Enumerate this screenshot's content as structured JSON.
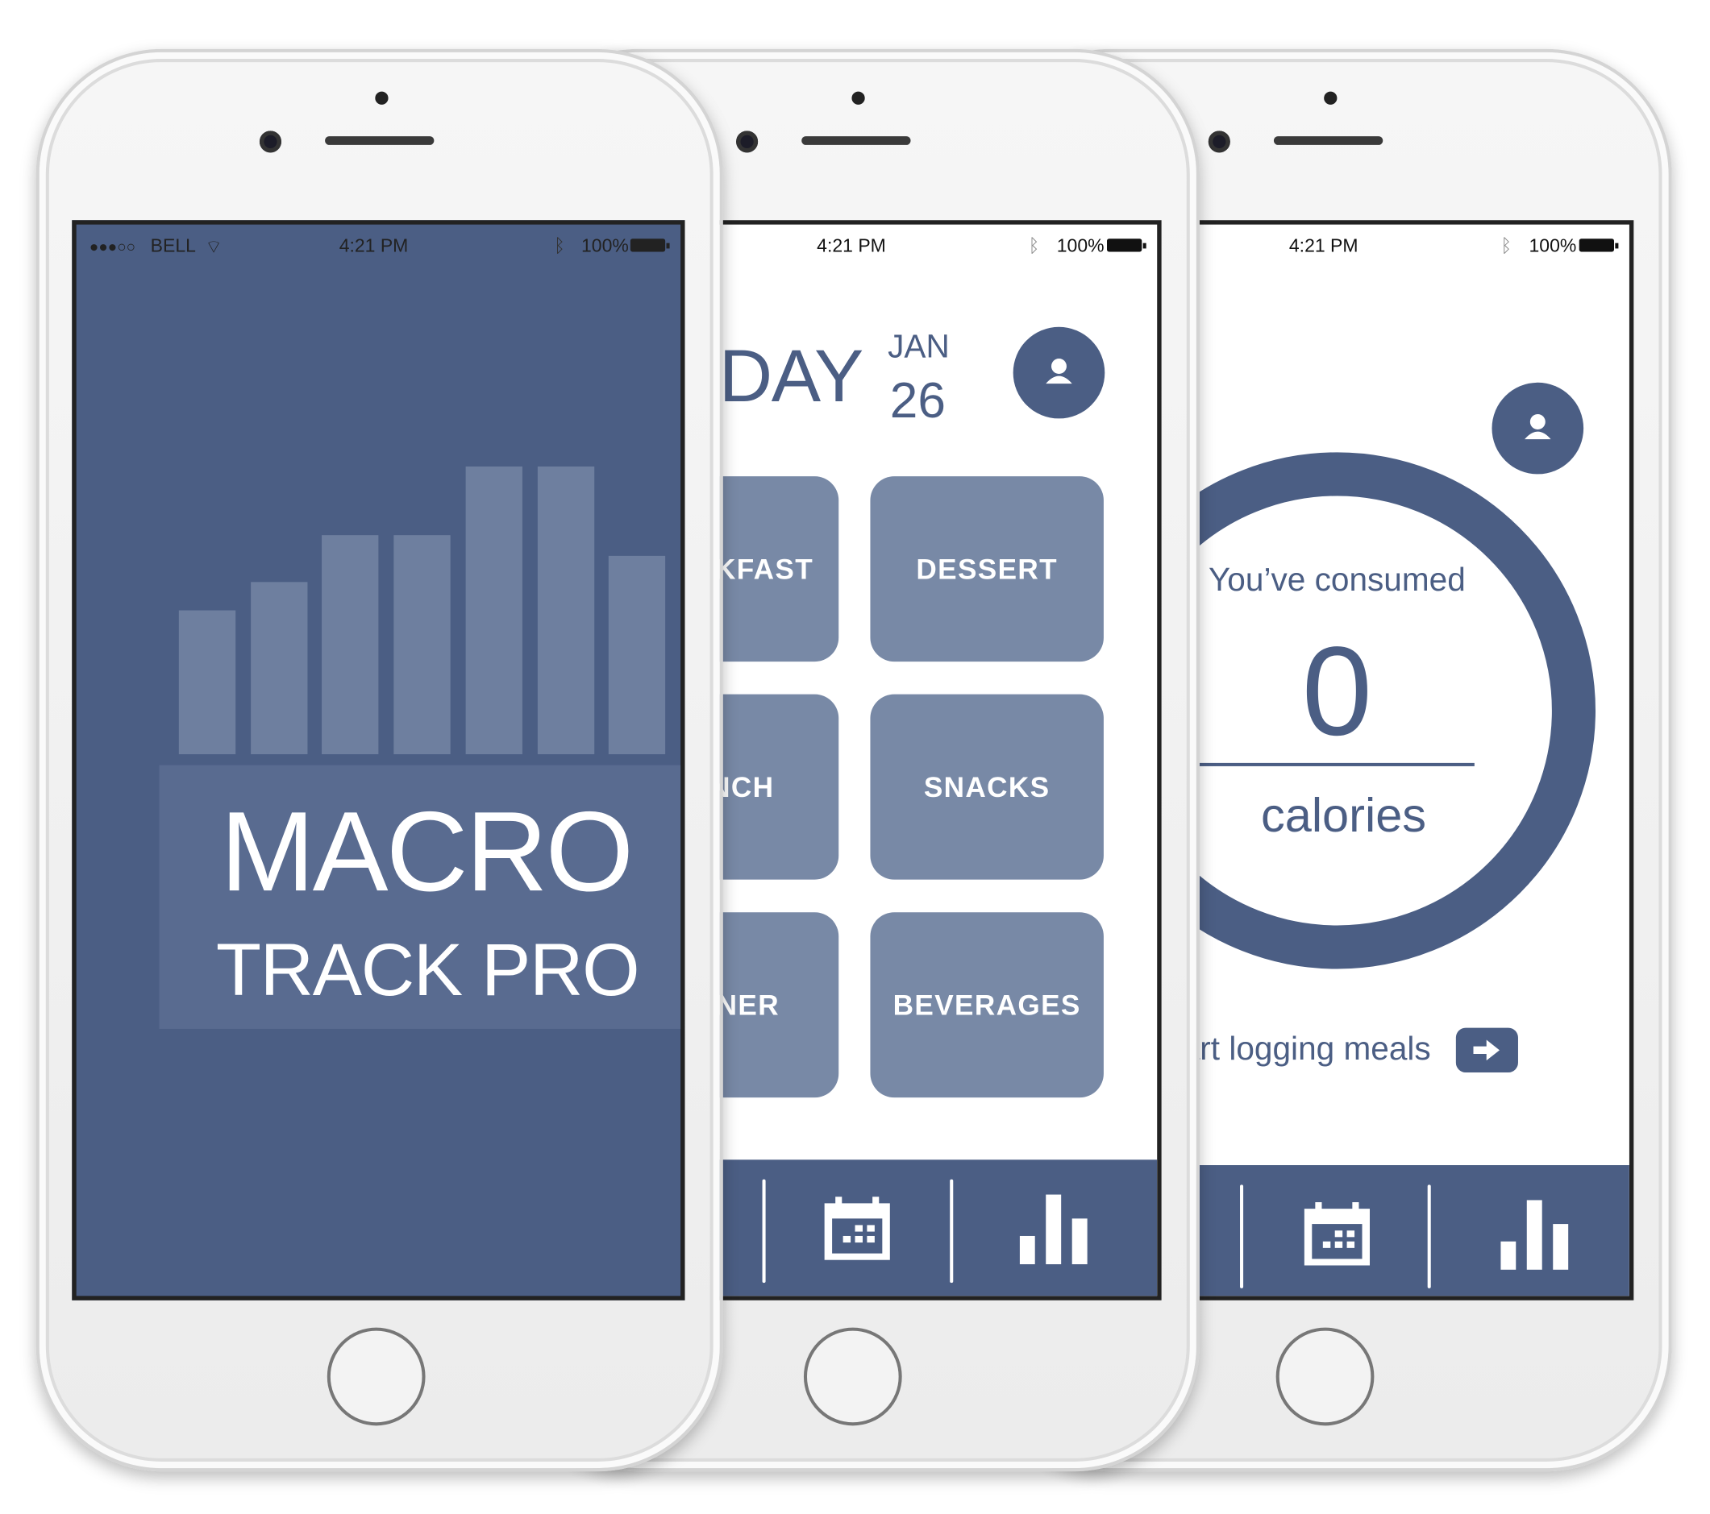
{
  "colors": {
    "brand": "#4b5e84",
    "tile": "#7889a6",
    "splash_bars": "#6e7f9f"
  },
  "status_bar": {
    "signal": "●●●○○",
    "carrier": "BELL",
    "time": "4:21 PM",
    "battery": "100%",
    "icons": [
      "wifi-icon",
      "bluetooth-icon",
      "battery-icon"
    ]
  },
  "splash": {
    "title": "MACRO",
    "subtitle": "TRACK PRO",
    "logo_bars": [
      5,
      6,
      7.6,
      7.6,
      10,
      10,
      6.9
    ]
  },
  "meals_screen": {
    "day_label": "TODAY",
    "month": "JAN",
    "date": "26",
    "meals": [
      "BREAKFAST",
      "DESSERT",
      "LUNCH",
      "SNACKS",
      "DINNER",
      "BEVERAGES"
    ],
    "tab_icons": [
      "calendar-icon",
      "bar-chart-icon"
    ]
  },
  "summary_screen": {
    "consumed_label": "You’ve consumed",
    "calories_value": "0",
    "calories_unit": "calories",
    "cta": "Start logging meals",
    "tab_icons": [
      "calendar-icon",
      "bar-chart-icon"
    ]
  }
}
